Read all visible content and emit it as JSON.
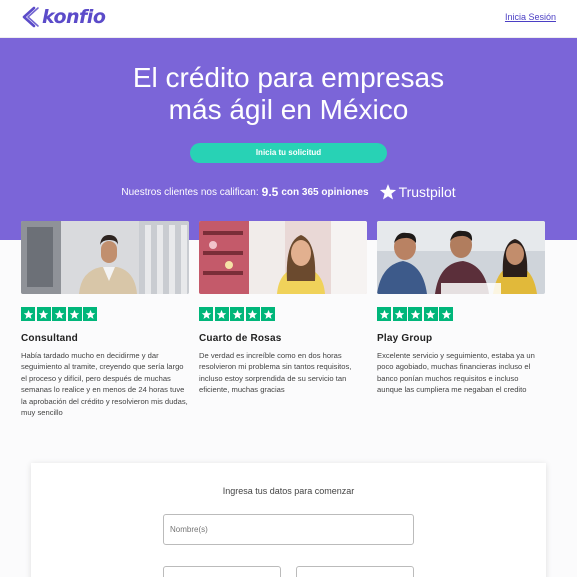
{
  "header": {
    "logo_text": "konfio",
    "login_label": "Inicia Sesión"
  },
  "hero": {
    "title_line1": "El crédito para empresas",
    "title_line2": "más ágil en México",
    "cta_label": "Inicia tu solicitud",
    "rating_prefix": "Nuestros clientes nos califican:",
    "rating_score": "9.5",
    "rating_reviews": "con 365 opiniones",
    "trustpilot_label": "Trustpilot",
    "colors": {
      "background": "#7b65d8",
      "cta": "#28d2b5"
    }
  },
  "testimonials": [
    {
      "name": "Consultand",
      "stars": 5,
      "text": "Había tardado mucho en decidirme y dar seguimiento al tramite, creyendo que sería largo el proceso y difícil, pero después de muchas semanas lo realice y en menos de 24 horas tuve la aprobación del crédito y resolvieron mis dudas, muy sencillo"
    },
    {
      "name": "Cuarto de Rosas",
      "stars": 5,
      "text": "De verdad es increíble como en dos horas resolvieron mi problema sin tantos requisitos, incluso estoy sorprendida de su servicio tan eficiente, muchas gracias"
    },
    {
      "name": "Play Group",
      "stars": 5,
      "text": "Excelente servicio y seguimiento, estaba ya un poco agobiado, muchas financieras incluso el banco ponían muchos requisitos e incluso aunque las cumpliera me negaban el credito"
    }
  ],
  "form": {
    "heading": "Ingresa tus datos para comenzar",
    "name_placeholder": "Nombre(s)"
  },
  "star_color": "#00b67a"
}
